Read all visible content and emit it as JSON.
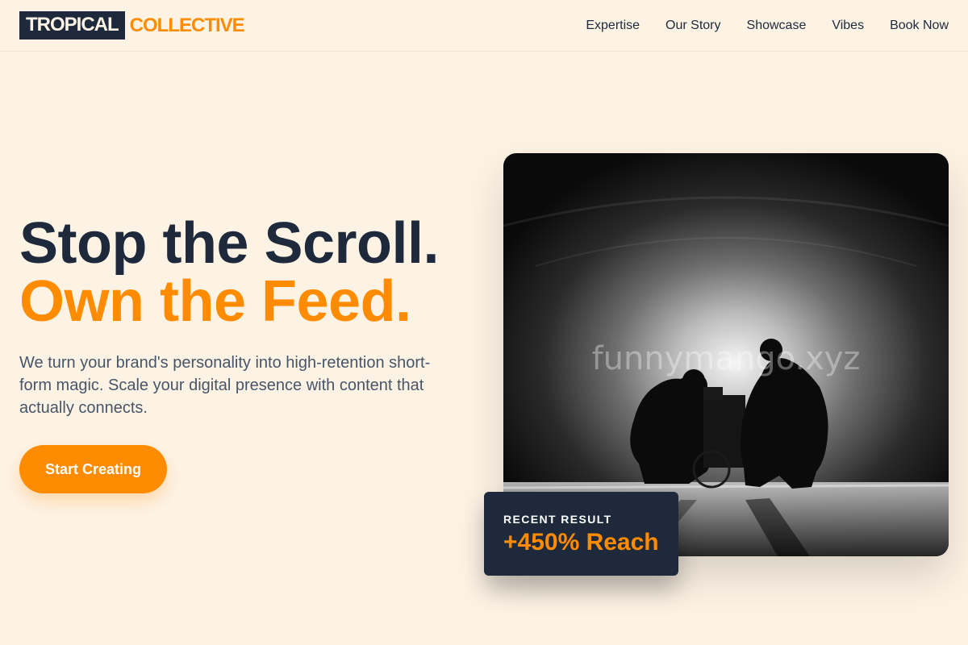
{
  "brand": {
    "primary": "TROPICAL",
    "accent": "COLLECTIVE"
  },
  "nav": {
    "items": [
      "Expertise",
      "Our Story",
      "Showcase",
      "Vibes",
      "Book Now"
    ]
  },
  "hero": {
    "title_line1": "Stop the Scroll.",
    "title_line2": "Own the Feed.",
    "description": "We turn your brand's personality into high-retention short-form magic. Scale your digital presence with content that actually connects.",
    "cta_label": "Start Creating"
  },
  "media": {
    "watermark": "funnymango.xyz"
  },
  "result": {
    "label": "RECENT RESULT",
    "value": "+450% Reach"
  },
  "colors": {
    "accent": "#ff8c00",
    "dark": "#1e293b",
    "background": "#fdf3e5",
    "muted": "#475569"
  }
}
